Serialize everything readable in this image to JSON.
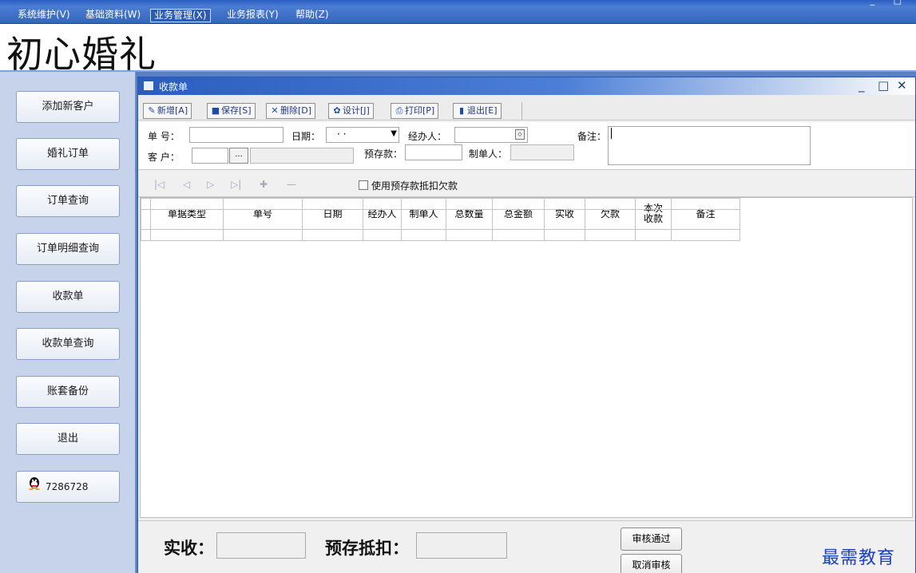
{
  "menu": [
    {
      "label": "系统维护(V)"
    },
    {
      "label": "基础资料(W)"
    },
    {
      "label": "业务管理(X)"
    },
    {
      "label": "业务报表(Y)"
    },
    {
      "label": "帮助(Z)"
    }
  ],
  "banner": {
    "brand": "初心婚礼"
  },
  "sidebar": {
    "items": [
      {
        "label": "添加新客户"
      },
      {
        "label": "婚礼订单"
      },
      {
        "label": "订单查询"
      },
      {
        "label": "订单明细查询"
      },
      {
        "label": "收款单"
      },
      {
        "label": "收款单查询"
      },
      {
        "label": "账套备份"
      },
      {
        "label": "退出"
      }
    ],
    "qq": "7286728"
  },
  "window": {
    "title": "收款单",
    "toolbar": {
      "add": "新增[A]",
      "save": "保存[S]",
      "delete": "删除[D]",
      "design": "设计[J]",
      "print": "打印[P]",
      "exit": "退出[E]"
    },
    "form": {
      "no_label": "单  号：",
      "date_label": "日期：",
      "date_value": "· ·",
      "handler_label": "经办人：",
      "remark_label": "备注：",
      "customer_label": "客  户：",
      "browse": "...",
      "prepay_label": "预存款：",
      "creator_label": "制单人："
    },
    "use_prepay_label": "使用预存款抵扣欠款",
    "grid": {
      "columns": [
        "单据类型",
        "单号",
        "日期",
        "经办人",
        "制单人",
        "总数量",
        "总金额",
        "实收",
        "欠款",
        "本次收款",
        "备注"
      ]
    },
    "footer": {
      "received_label": "实收：",
      "prepay_deduct_label": "预存抵扣：",
      "approve": "审核通过",
      "cancel_approve": "取消审核",
      "brand": "最需教育"
    }
  }
}
